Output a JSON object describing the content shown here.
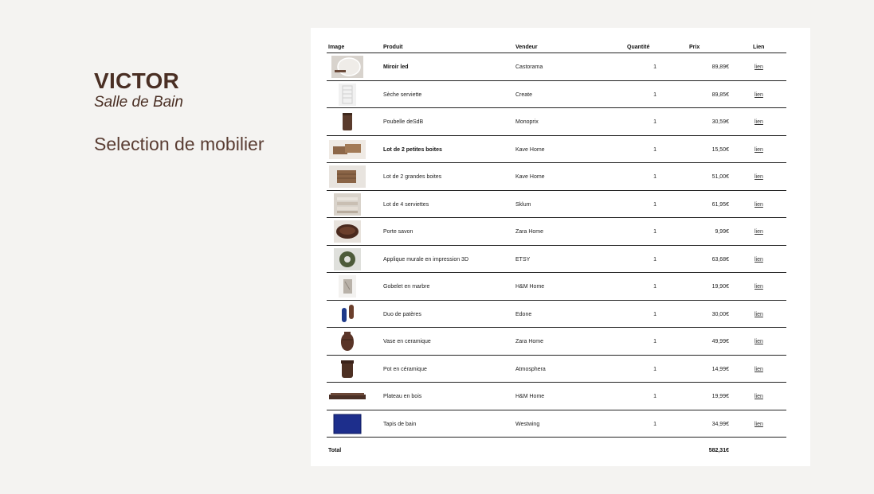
{
  "project": {
    "client": "VICTOR",
    "room": "Salle de Bain",
    "title": "Selection de mobilier"
  },
  "table": {
    "headers": {
      "image": "Image",
      "product": "Produit",
      "vendor": "Vendeur",
      "quantity": "Quantité",
      "price": "Prix",
      "link": "Lien"
    },
    "rows": [
      {
        "product": "Miroir led",
        "vendor": "Castorama",
        "quantity": "1",
        "price": "89,89€",
        "link": "lien",
        "bold": true,
        "icon": "mirror-icon"
      },
      {
        "product": "Sèche serviette",
        "vendor": "Create",
        "quantity": "1",
        "price": "89,85€",
        "link": "lien",
        "bold": false,
        "icon": "towel-dryer-icon"
      },
      {
        "product": "Poubelle deSdB",
        "vendor": "Monoprix",
        "quantity": "1",
        "price": "30,59€",
        "link": "lien",
        "bold": false,
        "icon": "trash-bin-icon"
      },
      {
        "product": "Lot de 2 petites boites",
        "vendor": "Kave Home",
        "quantity": "1",
        "price": "15,50€",
        "link": "lien",
        "bold": true,
        "icon": "small-boxes-icon"
      },
      {
        "product": "Lot de 2 grandes boites",
        "vendor": "Kave Home",
        "quantity": "1",
        "price": "51,00€",
        "link": "lien",
        "bold": false,
        "icon": "large-boxes-icon"
      },
      {
        "product": "Lot de 4 serviettes",
        "vendor": "Sklum",
        "quantity": "1",
        "price": "61,95€",
        "link": "lien",
        "bold": false,
        "icon": "towels-icon"
      },
      {
        "product": "Porte savon",
        "vendor": "Zara Home",
        "quantity": "1",
        "price": "9,99€",
        "link": "lien",
        "bold": false,
        "icon": "soap-dish-icon"
      },
      {
        "product": "Applique murale en impression 3D",
        "vendor": "ETSY",
        "quantity": "1",
        "price": "63,68€",
        "link": "lien",
        "bold": false,
        "icon": "wall-lamp-icon"
      },
      {
        "product": "Gobelet en marbre",
        "vendor": "H&M Home",
        "quantity": "1",
        "price": "19,90€",
        "link": "lien",
        "bold": false,
        "icon": "marble-cup-icon"
      },
      {
        "product": "Duo de patères",
        "vendor": "Edone",
        "quantity": "1",
        "price": "30,00€",
        "link": "lien",
        "bold": false,
        "icon": "wall-hooks-icon"
      },
      {
        "product": "Vase en ceramique",
        "vendor": "Zara Home",
        "quantity": "1",
        "price": "49,99€",
        "link": "lien",
        "bold": false,
        "icon": "vase-icon"
      },
      {
        "product": "Pot en céramique",
        "vendor": "Atmosphera",
        "quantity": "1",
        "price": "14,99€",
        "link": "lien",
        "bold": false,
        "icon": "pot-icon"
      },
      {
        "product": "Plateau en bois",
        "vendor": "H&M Home",
        "quantity": "1",
        "price": "19,99€",
        "link": "lien",
        "bold": false,
        "icon": "wooden-tray-icon"
      },
      {
        "product": "Tapis de bain",
        "vendor": "Westwing",
        "quantity": "1",
        "price": "34,99€",
        "link": "lien",
        "bold": false,
        "icon": "bath-mat-icon"
      }
    ],
    "total": {
      "label": "Total",
      "price": "582,31€"
    }
  }
}
